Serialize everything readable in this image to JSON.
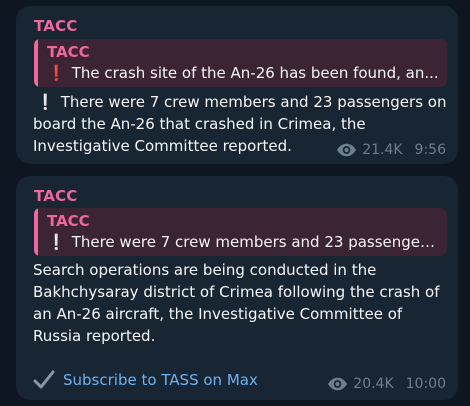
{
  "messages": [
    {
      "sender": "TACC",
      "reply": {
        "author": "TACC",
        "marker": "❗",
        "text": "The crash site of the An-26 has been found, an..."
      },
      "marker": "❕",
      "body": "There were 7 crew members and 23 passengers on board the An-26 that crashed in Crimea, the Investigative Committee reported.",
      "views": "21.4K",
      "time": "9:56"
    },
    {
      "sender": "TACC",
      "reply": {
        "author": "TACC",
        "marker": "❕",
        "text": "There were 7 crew members and 23 passenger..."
      },
      "body": "Search operations are being conducted in the Bakhchysaray district of Crimea following the crash of an An-26 aircraft, the Investigative Committee of Russia reported.",
      "subscribe": "Subscribe to TASS on Max",
      "views": "20.4K",
      "time": "10:00"
    }
  ],
  "colors": {
    "background": "#0e1621",
    "bubble": "#182533",
    "accent": "#f0679b",
    "link": "#6ab3f3",
    "meta": "#6d7f8f"
  },
  "icons": [
    "eye-icon",
    "check-icon"
  ]
}
